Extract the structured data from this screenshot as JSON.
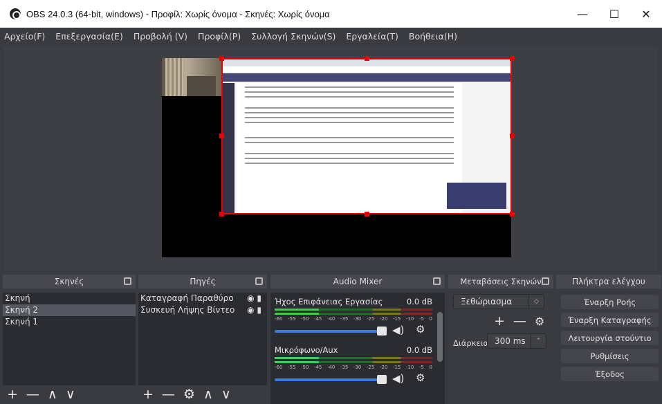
{
  "window": {
    "title": "OBS 24.0.3 (64-bit, windows) - Προφίλ: Χωρίς όνομα - Σκηνές: Χωρίς όνομα",
    "minimize": "—",
    "maximize": "☐",
    "close": "✕"
  },
  "menu": [
    "Αρχείο(F)",
    "Επεξεργασία(E)",
    "Προβολή (V)",
    "Προφίλ(P)",
    "Συλλογή Σκηνών(S)",
    "Εργαλεία(T)",
    "Βοήθεια(H)"
  ],
  "scenes": {
    "title": "Σκηνές",
    "items": [
      "Σκηνή",
      "Σκηνή 2",
      "Σκηνή 1"
    ],
    "selected": "Σκηνή 2"
  },
  "sources": {
    "title": "Πηγές",
    "items": [
      "Καταγραφή Παραθύρου",
      "Συσκευή Λήψης Βίντεο"
    ]
  },
  "mixer": {
    "title": "Audio Mixer",
    "tracks": [
      {
        "name": "Ήχος Επιφάνειας Εργασίας",
        "db": "0.0 dB",
        "volume": 1.0
      },
      {
        "name": "Μικρόφωνο/Aux",
        "db": "0.0 dB",
        "volume": 1.0
      }
    ],
    "scale": [
      "-60",
      "-55",
      "-50",
      "-45",
      "-40",
      "-35",
      "-30",
      "-25",
      "-20",
      "-15",
      "-10",
      "-5",
      "0"
    ]
  },
  "transitions": {
    "title": "Μεταβάσεις Σκηνών",
    "selected": "Ξεθώριασμα",
    "duration_label": "Διάρκεια",
    "duration": "300 ms"
  },
  "controls": {
    "title": "Πλήκτρα ελέγχου",
    "buttons": [
      "Έναρξη Ροής",
      "Έναρξη Καταγραφής",
      "Λειτουργία στούντιο",
      "Ρυθμίσεις",
      "Έξοδος"
    ]
  },
  "colors": {
    "background": "#3a3b40",
    "selection": "#e00000",
    "accent": "#3a7bd5"
  }
}
